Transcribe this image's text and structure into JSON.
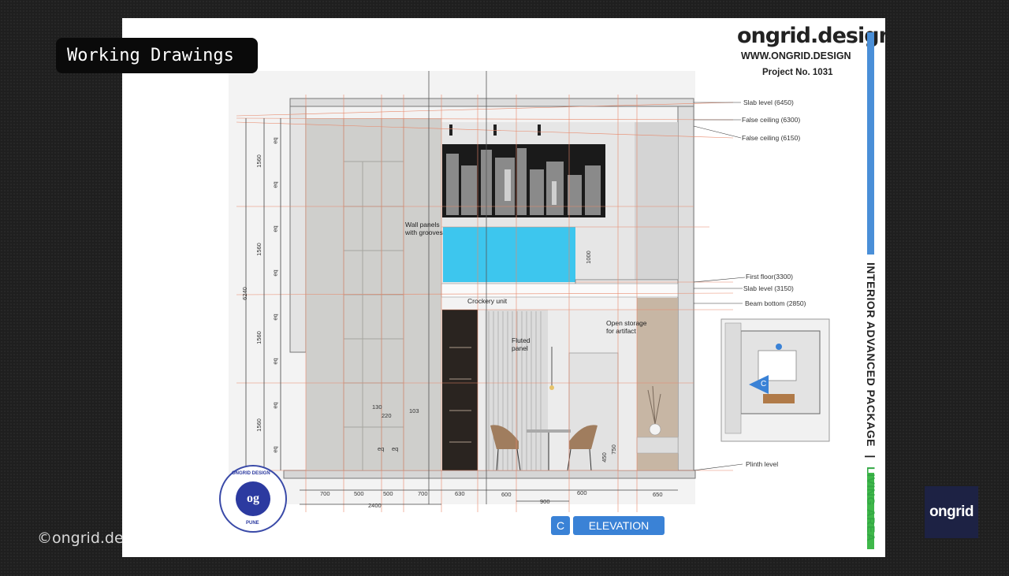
{
  "overlay": {
    "label": "Working Drawings",
    "copyright": "©ongrid.de",
    "corner_logo": "ongrid"
  },
  "titleblock": {
    "brand": "ongrid.design",
    "url": "WWW.ONGRID.DESIGN",
    "project": "Project No. 1031",
    "package": "INTERIOR ADVANCED PACKAGE",
    "separator": "|",
    "area": "LIVING AREA",
    "colors": {
      "package_bar": "#4a8fd8",
      "area_bar": "#3fb84a",
      "package_text": "#222222",
      "area_text": "#33a844"
    }
  },
  "levels": [
    "Slab level (6450)",
    "False ceiling (6300)",
    "False ceiling (6150)",
    "First floor(3300)",
    "Slab level (3150)",
    "Beam bottom (2850)",
    "Plinth level"
  ],
  "annotations": {
    "wall_panels": "Wall panels\nwith grooves",
    "crockery": "Crockery unit",
    "fluted": "Fluted\npanel",
    "open_storage": "Open storage\nfor artifact"
  },
  "dimensions": {
    "overall_height": "6240",
    "left_segments": [
      "1560",
      "1560",
      "1560",
      "1560"
    ],
    "eq": "eq",
    "railing": "1000",
    "panel_groove": [
      "130",
      "220",
      "103"
    ],
    "table_h": "450",
    "chair_h": "750",
    "bottom_row1": [
      "700",
      "500",
      "500",
      "700",
      "630",
      "600",
      "600",
      "650"
    ],
    "bottom_row2": [
      "2400",
      "900"
    ]
  },
  "elevation": {
    "code": "C",
    "label": "ELEVATION"
  },
  "keyplan": {
    "marker": "C"
  },
  "stamp": {
    "monogram": "og",
    "top_text": "ONGRID DESIGN",
    "bottom_text": "PUNE"
  }
}
